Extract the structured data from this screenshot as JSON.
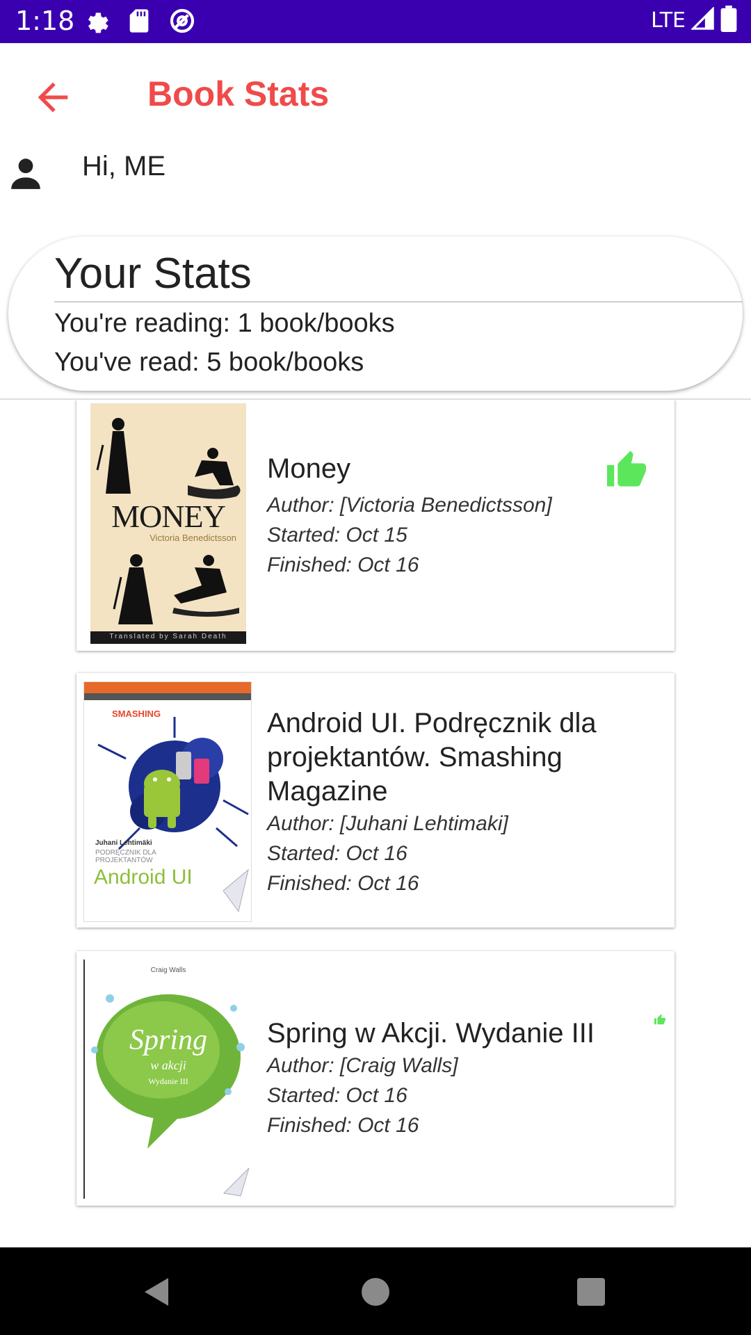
{
  "status_bar": {
    "time": "1:18",
    "network": "LTE",
    "icons": [
      "gear-icon",
      "sd-card-icon",
      "at-sign-icon",
      "signal-icon",
      "battery-icon"
    ]
  },
  "app_bar": {
    "title": "Book Stats",
    "back_icon": "arrow-left-icon",
    "accent_color": "#f04a4a"
  },
  "greeting": {
    "text": "Hi, ME",
    "icon": "person-icon"
  },
  "stats": {
    "heading": "Your Stats",
    "reading": "You're reading: 1 book/books",
    "read": "You've read: 5 book/books"
  },
  "books": [
    {
      "title": "Money",
      "author": "Author: [Victoria Benedictsson]",
      "started": "Started: Oct 15",
      "finished": "Finished: Oct 16",
      "liked": true,
      "cover_title": "MONEY",
      "cover_author": "Victoria Benedictsson",
      "cover_footer": "Translated by Sarah Death"
    },
    {
      "title": "Android UI. Podręcznik dla projektantów. Smashing Magazine",
      "author": "Author: [Juhani Lehtimaki]",
      "started": "Started: Oct 16",
      "finished": "Finished: Oct 16",
      "liked": false,
      "cover_publisher": "SMASHING",
      "cover_author": "Juhani Lehtimäki",
      "cover_subtitle": "PODRĘCZNIK DLA PROJEKTANTÓW",
      "cover_title": "Android UI"
    },
    {
      "title": "Spring w Akcji. Wydanie III",
      "author": "Author: [Craig Walls]",
      "started": "Started: Oct 16",
      "finished": "Finished: Oct 16",
      "liked": true,
      "cover_author": "Craig Walls",
      "cover_title": "Spring",
      "cover_subtitle": "w akcji",
      "cover_edition": "Wydanie III"
    }
  ],
  "colors": {
    "status_bar": "#3a00b0",
    "like_green": "#5ce65c",
    "nav_bar": "#000000"
  },
  "nav_bar": {
    "buttons": [
      "back-triangle-icon",
      "home-circle-icon",
      "recents-square-icon"
    ]
  }
}
